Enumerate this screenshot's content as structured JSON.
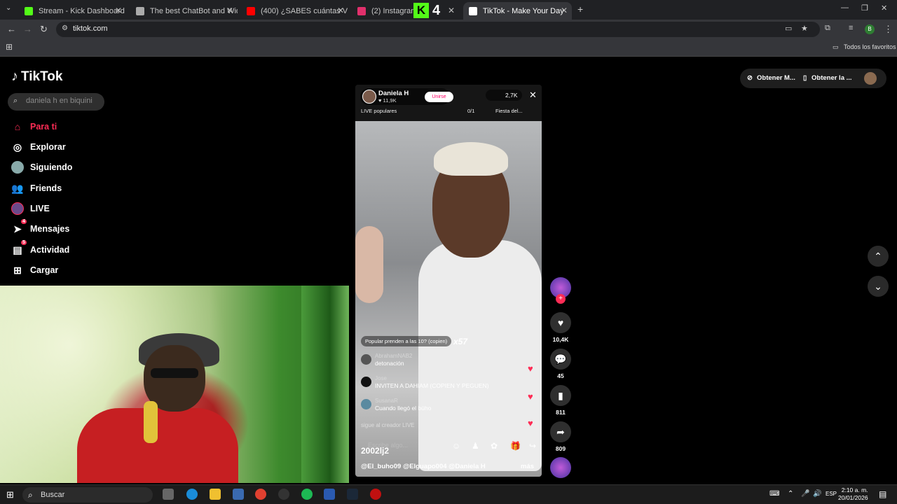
{
  "browser": {
    "tabs": [
      {
        "title": "Stream - Kick Dashboard",
        "color": "#53fc18"
      },
      {
        "title": "The best ChatBot and Widgets",
        "color": "#aaaaaa"
      },
      {
        "title": "(400) ¿SABES cuántas VIDAS CU",
        "color": "#ff0000"
      },
      {
        "title": "(2) Instagram",
        "color": "#e1306c"
      },
      {
        "title": "TikTok - Make Your Day",
        "color": "#ffffff"
      }
    ],
    "kick_badge": "4",
    "url": "tiktok.com",
    "bookmarks_label": "Todos los favoritos"
  },
  "sidebar": {
    "logo": "TikTok",
    "search_placeholder": "daniela h en biquini",
    "items": [
      {
        "label": "Para ti",
        "icon": "home-icon"
      },
      {
        "label": "Explorar",
        "icon": "compass-icon"
      },
      {
        "label": "Siguiendo",
        "icon": "avatar-icon"
      },
      {
        "label": "Friends",
        "icon": "friends-icon"
      },
      {
        "label": "LIVE",
        "icon": "live-icon"
      },
      {
        "label": "Mensajes",
        "icon": "messages-icon",
        "badge": "4"
      },
      {
        "label": "Actividad",
        "icon": "activity-icon",
        "badge": "5"
      },
      {
        "label": "Cargar",
        "icon": "upload-icon"
      }
    ]
  },
  "video": {
    "host_name": "Daniela H",
    "host_likes": "♥ 11,9K",
    "join_label": "Unirse",
    "viewers": "2,7K",
    "live_popular": "LIVE populares",
    "score": "0/1",
    "fiesta": "Fiesta del...",
    "popular_note": "Popular prenden a las 10? (copien)",
    "combo": "x57",
    "comments": [
      {
        "user": "AbrahamNAB2",
        "text": "detonación"
      },
      {
        "user": "Jose",
        "text": "INVITEN A DAHIAM (COPIEN Y PEGUEN)"
      },
      {
        "user": "SusanaR",
        "text": "Cuando llegó el búho"
      }
    ],
    "follow_note": "sigue al creador LIVE",
    "comment_placeholder": "Escribe algo...",
    "code_label": "2002lj2",
    "caption": "@El_buho09 @Elguapo004 @Daniela H",
    "more": "más"
  },
  "actions": {
    "likes": "10,4K",
    "comments": "45",
    "saves": "811",
    "shares": "809"
  },
  "topright": {
    "btn1": "Obtener M...",
    "btn2": "Obtener la ..."
  },
  "taskbar": {
    "search_label": "Buscar",
    "lang": "ESP",
    "time": "2:10 a. m.",
    "date": "20/01/2026"
  }
}
